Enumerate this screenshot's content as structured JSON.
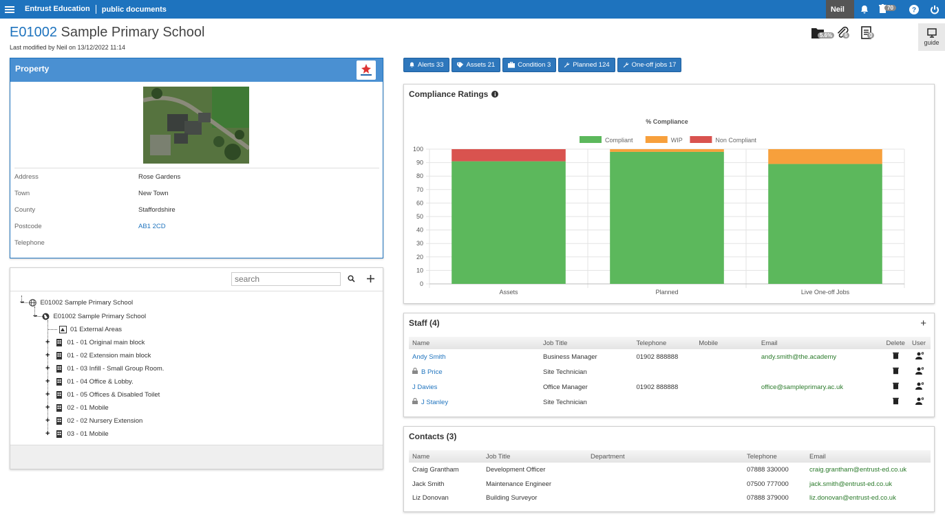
{
  "topbar": {
    "brand": "Entrust Education",
    "crumb": "public documents",
    "user": "Neil",
    "bin_count": "70"
  },
  "header": {
    "code": "E01002",
    "name": "Sample Primary School",
    "last_modified": "Last modified by Neil on 13/12/2022 11:14",
    "badges": {
      "docs": "5.6%",
      "attachments": "6",
      "notes": "0"
    },
    "guide_label": "guide"
  },
  "property": {
    "title": "Property",
    "rows": [
      {
        "label": "Address",
        "value": "Rose Gardens"
      },
      {
        "label": "Town",
        "value": "New Town"
      },
      {
        "label": "County",
        "value": "Staffordshire"
      },
      {
        "label": "Postcode",
        "value": "AB1 2CD"
      },
      {
        "label": "Telephone",
        "value": ""
      }
    ]
  },
  "tree": {
    "search_placeholder": "search",
    "root": "E01002 Sample Primary School",
    "site": "E01002 Sample Primary School",
    "items": [
      "01 External Areas",
      "01 - 01 Original main block",
      "01 - 02 Extension main block",
      "01 - 03 Infill - Small Group Room.",
      "01 - 04 Office & Lobby.",
      "01 - 05 Offices & Disabled Toilet",
      "02 - 01 Mobile",
      "02 - 02 Nursery Extension",
      "03 - 01 Mobile"
    ]
  },
  "tabs": [
    {
      "label": "Alerts 33",
      "icon": "bell-icon"
    },
    {
      "label": "Assets 21",
      "icon": "tag-icon"
    },
    {
      "label": "Condition 3",
      "icon": "briefcase-icon"
    },
    {
      "label": "Planned 124",
      "icon": "wrench-icon"
    },
    {
      "label": "One-off jobs 17",
      "icon": "wrench-icon"
    }
  ],
  "compliance": {
    "title": "Compliance Ratings"
  },
  "chart_data": {
    "type": "bar",
    "stacked": true,
    "title": "% Compliance",
    "categories": [
      "Assets",
      "Planned",
      "Live One-off Jobs"
    ],
    "series": [
      {
        "name": "Compliant",
        "color": "#5cb85c",
        "values": [
          91,
          98,
          89
        ]
      },
      {
        "name": "WIP",
        "color": "#f7a03c",
        "values": [
          0,
          2,
          11
        ]
      },
      {
        "name": "Non Compliant",
        "color": "#d9534f",
        "values": [
          9,
          0,
          0
        ]
      }
    ],
    "ylim": [
      0,
      100
    ],
    "yticks": [
      0,
      10,
      20,
      30,
      40,
      50,
      60,
      70,
      80,
      90,
      100
    ],
    "legend_position": "top",
    "grid": true
  },
  "staff": {
    "title": "Staff (4)",
    "columns": [
      "Name",
      "Job Title",
      "Telephone",
      "Mobile",
      "Email",
      "Delete",
      "User"
    ],
    "rows": [
      {
        "name": "Andy Smith",
        "locked": false,
        "job": "Business Manager",
        "tel": "01902 888888",
        "mobile": "",
        "email": "andy.smith@the.academy"
      },
      {
        "name": "B Price",
        "locked": true,
        "job": "Site Technician",
        "tel": "",
        "mobile": "",
        "email": ""
      },
      {
        "name": "J Davies",
        "locked": false,
        "job": "Office Manager",
        "tel": "01902 888888",
        "mobile": "",
        "email": "office@sampleprimary.ac.uk"
      },
      {
        "name": "J Stanley",
        "locked": true,
        "job": "Site Technician",
        "tel": "",
        "mobile": "",
        "email": ""
      }
    ]
  },
  "contacts": {
    "title": "Contacts (3)",
    "columns": [
      "Name",
      "Job Title",
      "Department",
      "Telephone",
      "Email"
    ],
    "rows": [
      {
        "name": "Craig Grantham",
        "job": "Development Officer",
        "dept": "",
        "tel": "07888 330000",
        "email": "craig.grantham@entrust-ed.co.uk"
      },
      {
        "name": "Jack Smith",
        "job": "Maintenance Engineer",
        "dept": "",
        "tel": "07500 777000",
        "email": "jack.smith@entrust-ed.co.uk"
      },
      {
        "name": "Liz Donovan",
        "job": "Building Surveyor",
        "dept": "",
        "tel": "07888 379000",
        "email": "liz.donovan@entrust-ed.co.uk"
      }
    ]
  }
}
